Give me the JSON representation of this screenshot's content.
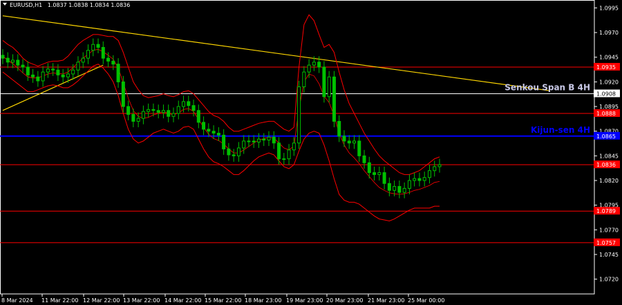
{
  "header": {
    "symbol": "EURUSD,H1",
    "ohlc": "1.0837 1.0838 1.0834 1.0836"
  },
  "chart_data": {
    "type": "candlestick",
    "symbol": "EURUSD",
    "timeframe": "H1",
    "ylim": [
      1.0705,
      1.1003
    ],
    "y_ticks": [
      "1.0995",
      "1.0970",
      "1.0945",
      "1.0920",
      "1.0895",
      "1.0870",
      "1.0845",
      "1.0820",
      "1.0795",
      "1.0770",
      "1.0745",
      "1.0720"
    ],
    "x_ticks": [
      "8 Mar 2024",
      "11 Mar 22:00",
      "12 Mar 22:00",
      "13 Mar 22:00",
      "14 Mar 22:00",
      "15 Mar 22:00",
      "18 Mar 23:00",
      "19 Mar 23:00",
      "20 Mar 23:00",
      "21 Mar 23:00",
      "25 Mar 00:00"
    ],
    "levels": [
      {
        "label": "1.0935",
        "value": 1.0935,
        "color": "#ff0000",
        "badge": "#ff0000"
      },
      {
        "label": "1.0908",
        "value": 1.0908,
        "color": "#ffffff",
        "badge": "#ffffff"
      },
      {
        "label": "1.0888",
        "value": 1.0888,
        "color": "#ff0000",
        "badge": "#ff0000"
      },
      {
        "label": "1.0865",
        "value": 1.0865,
        "color": "#0000ff",
        "badge": "#0000ff"
      },
      {
        "label": "1.0836",
        "value": 1.0836,
        "color": "#ff0000",
        "badge": "#ff0000"
      },
      {
        "label": "1.0789",
        "value": 1.0789,
        "color": "#ff0000",
        "badge": "#ff0000"
      },
      {
        "label": "1.0757",
        "value": 1.0757,
        "color": "#ff0000",
        "badge": "#ff0000"
      }
    ],
    "annotations": [
      {
        "text": "Senkou Span B 4H",
        "color": "#c8c8e6",
        "level": 1.0908
      },
      {
        "text": "Kijun-sen 4H",
        "color": "#0000ff",
        "level": 1.0865
      }
    ],
    "trendline": {
      "from": [
        0,
        1.0987
      ],
      "to": [
        109,
        1.0911
      ],
      "color": "#ffd700"
    },
    "trendline2": {
      "from": [
        0,
        1.0891
      ],
      "to": [
        20,
        1.0937
      ],
      "color": "#ffd700"
    },
    "close_series": [
      1.0944,
      1.094,
      1.0942,
      1.0937,
      1.0935,
      1.0927,
      1.0925,
      1.0921,
      1.093,
      1.0933,
      1.0932,
      1.0927,
      1.0925,
      1.0928,
      1.0932,
      1.094,
      1.0944,
      1.0952,
      1.0958,
      1.0955,
      1.0944,
      1.0941,
      1.0938,
      1.092,
      1.0895,
      1.0887,
      1.088,
      1.0883,
      1.089,
      1.0892,
      1.0891,
      1.0889,
      1.0891,
      1.0885,
      1.0888,
      1.0895,
      1.09,
      1.0896,
      1.0891,
      1.0879,
      1.0872,
      1.087,
      1.0868,
      1.0866,
      1.0852,
      1.0846,
      1.0845,
      1.0853,
      1.086,
      1.086,
      1.0859,
      1.0862,
      1.0861,
      1.0864,
      1.0858,
      1.0842,
      1.0842,
      1.0851,
      1.0858,
      1.0915,
      1.093,
      1.0937,
      1.094,
      1.0935,
      1.0905,
      1.0925,
      1.088,
      1.0865,
      1.086,
      1.0858,
      1.086,
      1.0845,
      1.0838,
      1.0828,
      1.0826,
      1.0828,
      1.0817,
      1.081,
      1.0814,
      1.0808,
      1.0812,
      1.082,
      1.0822,
      1.082,
      1.0823,
      1.083,
      1.0834,
      1.0836
    ],
    "ichimoku_upper": [
      1.0962,
      1.0958,
      1.0955,
      1.095,
      1.0944,
      1.094,
      1.0938,
      1.0936,
      1.0938,
      1.094,
      1.0941,
      1.0941,
      1.0942,
      1.0946,
      1.0952,
      1.0958,
      1.0962,
      1.0965,
      1.0968,
      1.0968,
      1.0967,
      1.0966,
      1.0966,
      1.0962,
      1.095,
      1.0935,
      1.092,
      1.0912,
      1.0906,
      1.0904,
      1.0905,
      1.0906,
      1.0908,
      1.0906,
      1.0905,
      1.0907,
      1.091,
      1.0911,
      1.0908,
      1.0902,
      1.0896,
      1.089,
      1.0886,
      1.0884,
      1.088,
      1.0874,
      1.087,
      1.087,
      1.0872,
      1.0874,
      1.0876,
      1.0878,
      1.0879,
      1.088,
      1.088,
      1.0876,
      1.0872,
      1.087,
      1.0874,
      1.0935,
      1.0978,
      1.0988,
      1.0982,
      1.0968,
      1.0955,
      1.0958,
      1.095,
      1.093,
      1.0912,
      1.0898,
      1.0888,
      1.0878,
      1.0868,
      1.086,
      1.0852,
      1.0845,
      1.084,
      1.0836,
      1.0832,
      1.0828,
      1.0826,
      1.0826,
      1.0828,
      1.083,
      1.0834,
      1.0838,
      1.0842,
      1.0844
    ],
    "ichimoku_lower": [
      1.093,
      1.0926,
      1.0922,
      1.0918,
      1.0914,
      1.091,
      1.091,
      1.0912,
      1.0914,
      1.0916,
      1.0917,
      1.0916,
      1.0914,
      1.0914,
      1.0917,
      1.0921,
      1.0926,
      1.0931,
      1.0936,
      1.0938,
      1.0934,
      1.0928,
      1.092,
      1.0906,
      1.0888,
      1.0872,
      1.0862,
      1.0858,
      1.086,
      1.0864,
      1.0868,
      1.087,
      1.0872,
      1.087,
      1.0868,
      1.087,
      1.0874,
      1.0875,
      1.0872,
      1.0862,
      1.0852,
      1.0844,
      1.0839,
      1.0837,
      1.0834,
      1.083,
      1.0826,
      1.0826,
      1.083,
      1.0835,
      1.084,
      1.0844,
      1.0846,
      1.0848,
      1.0846,
      1.084,
      1.0834,
      1.0832,
      1.0836,
      1.085,
      1.0862,
      1.0868,
      1.087,
      1.0868,
      1.0856,
      1.084,
      1.0822,
      1.0806,
      1.08,
      1.0798,
      1.0798,
      1.0796,
      1.0792,
      1.0788,
      1.0784,
      1.0781,
      1.078,
      1.0779,
      1.0781,
      1.0784,
      1.0787,
      1.079,
      1.0792,
      1.0792,
      1.0792,
      1.0792,
      1.0794,
      1.0794
    ]
  }
}
